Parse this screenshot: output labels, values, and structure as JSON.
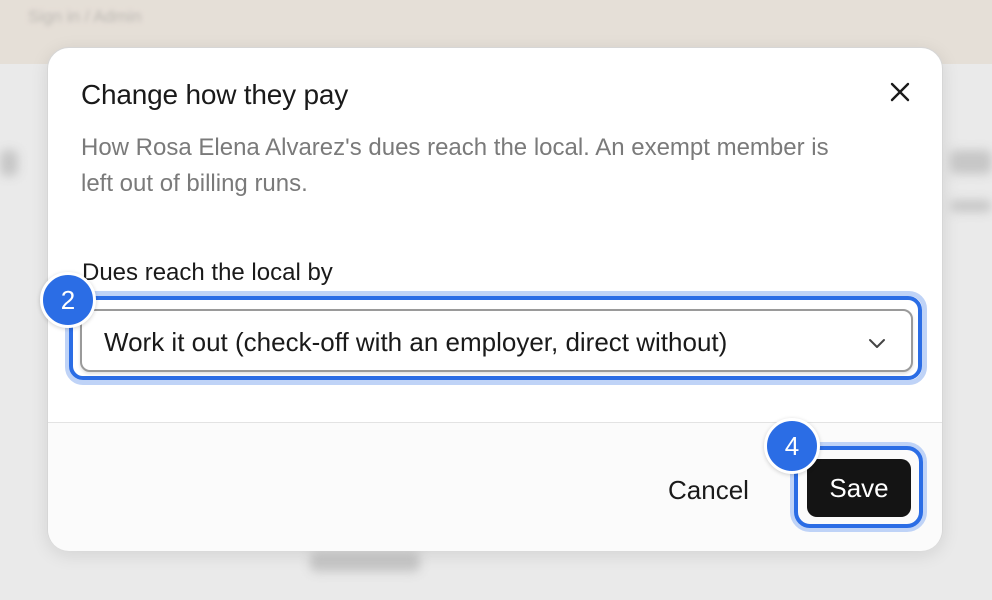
{
  "background": {
    "banner_text": "Sign in / Admin"
  },
  "dialog": {
    "title": "Change how they pay",
    "description": "How Rosa Elena Alvarez's dues reach the local. An exempt member is left out of billing runs.",
    "close_icon": "close-icon",
    "field": {
      "label": "Dues reach the local by",
      "selected_value": "Work it out (check-off with an employer, direct without)",
      "chevron_icon": "chevron-down-icon"
    },
    "footer": {
      "cancel_label": "Cancel",
      "save_label": "Save"
    }
  },
  "annotations": {
    "select_step": "2",
    "save_step": "4"
  },
  "colors": {
    "accent": "#2b6de5",
    "focus_ring": "#bfd3f7",
    "primary_button": "#141414",
    "banner": "#e7ddd1"
  }
}
